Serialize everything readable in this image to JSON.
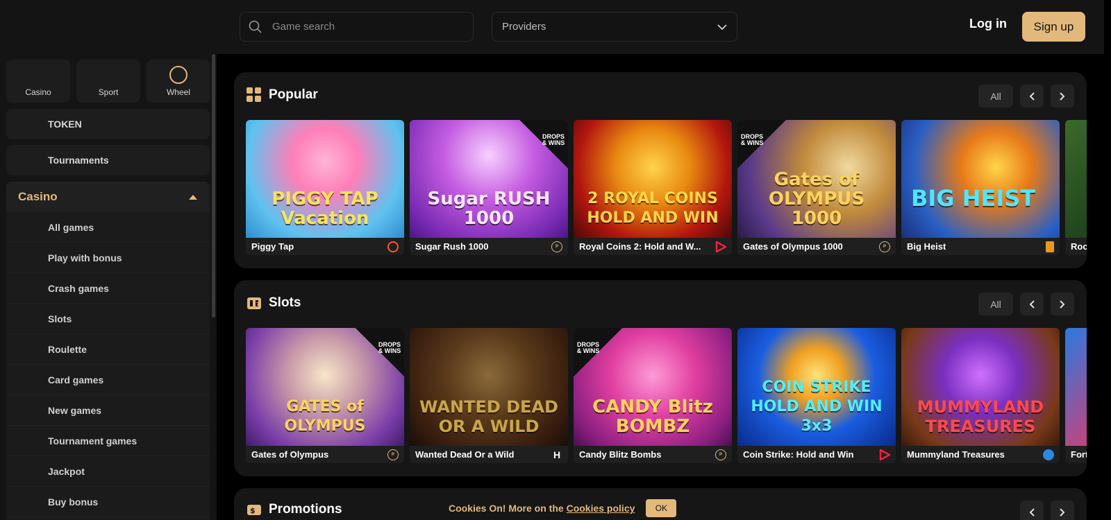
{
  "header": {
    "search_placeholder": "Game search",
    "providers_label": "Providers",
    "login_label": "Log in",
    "signup_label": "Sign up"
  },
  "sidebar": {
    "top_tabs": [
      {
        "label": "Casino"
      },
      {
        "label": "Sport"
      },
      {
        "label": "Wheel"
      }
    ],
    "token_label": "TOKEN",
    "tournaments_label": "Tournaments",
    "category_header": "Casino",
    "categories": [
      {
        "label": "All games"
      },
      {
        "label": "Play with bonus"
      },
      {
        "label": "Crash games"
      },
      {
        "label": "Slots"
      },
      {
        "label": "Roulette"
      },
      {
        "label": "Card games"
      },
      {
        "label": "New games"
      },
      {
        "label": "Tournament games"
      },
      {
        "label": "Jackpot"
      },
      {
        "label": "Buy bonus"
      }
    ]
  },
  "sections": {
    "popular": {
      "title": "Popular",
      "all_label": "All",
      "games": [
        {
          "name": "Piggy Tap",
          "art_text": "PIGGY TAP Vacation"
        },
        {
          "name": "Sugar Rush 1000",
          "art_text": "Sugar RUSH 1000",
          "badge": "DROPS & WINS"
        },
        {
          "name": "Royal Coins 2: Hold and W...",
          "art_text": "2 ROYAL COINS HOLD AND WIN"
        },
        {
          "name": "Gates of Olympus 1000",
          "art_text": "Gates of OLYMPUS 1000",
          "badge": "DROPS & WINS"
        },
        {
          "name": "Big Heist",
          "art_text": "BIG HEIST"
        },
        {
          "name": "Roc",
          "art_text": ""
        }
      ]
    },
    "slots": {
      "title": "Slots",
      "all_label": "All",
      "games": [
        {
          "name": "Gates of Olympus",
          "art_text": "GATES of OLYMPUS",
          "badge": "DROPS & WINS"
        },
        {
          "name": "Wanted Dead Or a Wild",
          "art_text": "WANTED DEAD OR A WILD"
        },
        {
          "name": "Candy Blitz Bombs",
          "art_text": "CANDY Blitz BOMBZ",
          "badge": "DROPS & WINS"
        },
        {
          "name": "Coin Strike: Hold and Win",
          "art_text": "COIN STRIKE HOLD AND WIN 3x3"
        },
        {
          "name": "Mummyland Treasures",
          "art_text": "MUMMYLAND TREASURES"
        },
        {
          "name": "Fort",
          "art_text": ""
        }
      ]
    },
    "promotions": {
      "title": "Promotions"
    }
  },
  "cookie": {
    "text": "Cookies On! More on the",
    "link": "Cookies policy",
    "ok": "OK"
  },
  "colors": {
    "accent": "#e3b87b",
    "background": "#000000",
    "panel": "#161616"
  }
}
